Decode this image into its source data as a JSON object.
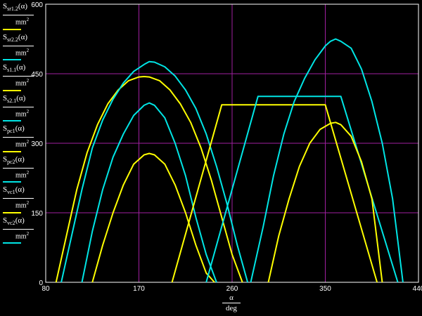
{
  "chart_data": {
    "type": "line",
    "xlabel_top": "α",
    "xlabel_bottom": "deg",
    "xlim": [
      80,
      440
    ],
    "ylim": [
      0,
      600
    ],
    "xticks": [
      80,
      170,
      260,
      350,
      440
    ],
    "yticks": [
      0,
      150,
      300,
      450,
      600
    ],
    "grid": true,
    "colors": {
      "background": "#000000",
      "grid": "#a020a0",
      "yellow": "#ffff00",
      "cyan": "#00e5e5"
    },
    "legend": [
      {
        "base": "S",
        "sub": "sr1.2",
        "arg": "(α)",
        "den_base": "mm",
        "den_sup": "2",
        "color": "#ffff00"
      },
      {
        "base": "S",
        "sub": "sr2.2",
        "arg": "(α)",
        "den_base": "mm",
        "den_sup": "2",
        "color": "#00e5e5"
      },
      {
        "base": "S",
        "sub": "s1.1",
        "arg": "(α)",
        "den_base": "mm",
        "den_sup": "2",
        "color": "#ffff00"
      },
      {
        "base": "S",
        "sub": "s2.1",
        "arg": "(α)",
        "den_base": "mm",
        "den_sup": "2",
        "color": "#00e5e5"
      },
      {
        "base": "S",
        "sub": "pc1",
        "arg": "(α)",
        "den_base": "mm",
        "den_sup": "2",
        "color": "#ffff00"
      },
      {
        "base": "S",
        "sub": "pc2",
        "arg": "(α)",
        "den_base": "mm",
        "den_sup": "2",
        "color": "#00e5e5"
      },
      {
        "base": "S",
        "sub": "vc1",
        "arg": "(α)",
        "den_base": "mm",
        "den_sup": "2",
        "color": "#ffff00"
      },
      {
        "base": "S",
        "sub": "vc2",
        "arg": "(α)",
        "den_base": "mm",
        "den_sup": "2",
        "color": "#00e5e5"
      }
    ],
    "series": [
      {
        "color": "#ffff00",
        "x": [
          90,
          100,
          110,
          120,
          130,
          140,
          150,
          160,
          170,
          175,
          180,
          190,
          200,
          210,
          220,
          230,
          240,
          250,
          260,
          270
        ],
        "y": [
          0,
          100,
          200,
          280,
          340,
          385,
          415,
          435,
          443,
          444,
          443,
          435,
          415,
          385,
          345,
          290,
          220,
          140,
          60,
          0
        ]
      },
      {
        "color": "#00e5e5",
        "x": [
          95,
          105,
          115,
          125,
          135,
          145,
          155,
          165,
          175,
          180,
          185,
          195,
          205,
          215,
          225,
          235,
          245,
          255,
          265,
          275
        ],
        "y": [
          0,
          100,
          200,
          290,
          350,
          395,
          430,
          455,
          470,
          476,
          475,
          465,
          445,
          415,
          375,
          320,
          250,
          170,
          80,
          0
        ]
      },
      {
        "color": "#ffff00",
        "x": [
          125,
          135,
          145,
          155,
          165,
          175,
          180,
          185,
          195,
          205,
          215,
          225,
          235,
          243
        ],
        "y": [
          0,
          80,
          150,
          210,
          255,
          275,
          278,
          275,
          255,
          210,
          150,
          80,
          20,
          0
        ]
      },
      {
        "color": "#00e5e5",
        "x": [
          115,
          125,
          135,
          145,
          155,
          165,
          175,
          180,
          185,
          195,
          205,
          215,
          225,
          235,
          245
        ],
        "y": [
          0,
          110,
          200,
          270,
          320,
          360,
          382,
          387,
          382,
          355,
          300,
          230,
          140,
          60,
          0
        ]
      },
      {
        "color": "#ffff00",
        "x": [
          202,
          250,
          350,
          400
        ],
        "y": [
          0,
          383,
          383,
          0
        ]
      },
      {
        "color": "#00e5e5",
        "x": [
          235,
          285,
          365,
          420
        ],
        "y": [
          0,
          401,
          401,
          0
        ]
      },
      {
        "color": "#ffff00",
        "x": [
          295,
          305,
          315,
          325,
          335,
          345,
          355,
          360,
          365,
          375,
          385,
          395,
          405
        ],
        "y": [
          0,
          100,
          180,
          250,
          300,
          330,
          343,
          345,
          340,
          315,
          260,
          180,
          0
        ]
      },
      {
        "color": "#00e5e5",
        "x": [
          278,
          290,
          300,
          310,
          320,
          330,
          340,
          350,
          355,
          360,
          365,
          375,
          385,
          395,
          405,
          415,
          425
        ],
        "y": [
          0,
          120,
          230,
          320,
          390,
          440,
          480,
          510,
          520,
          525,
          520,
          505,
          460,
          390,
          300,
          180,
          0
        ]
      }
    ]
  }
}
